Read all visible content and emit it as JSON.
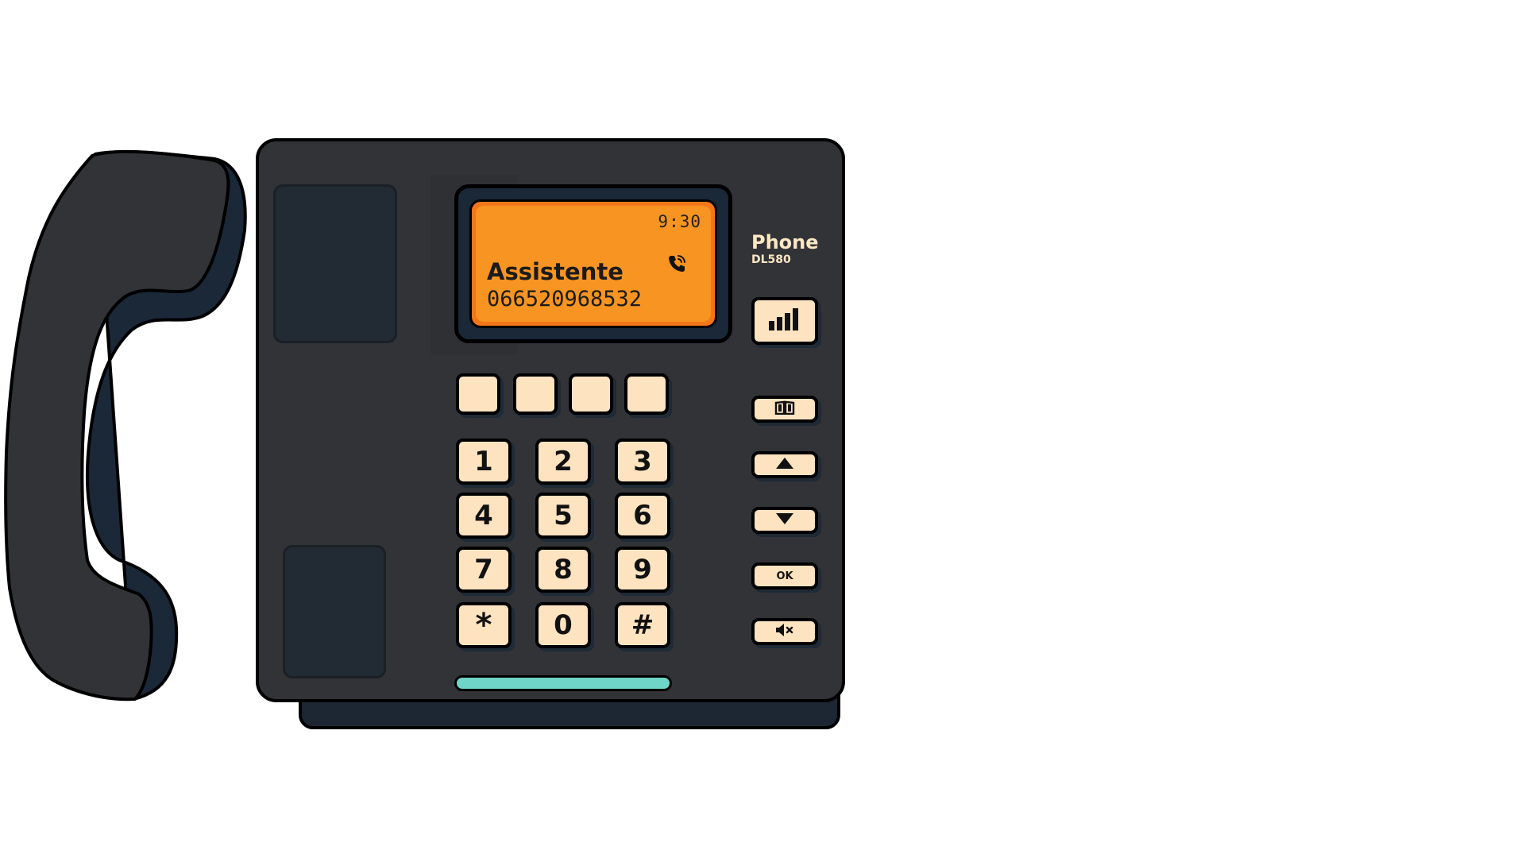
{
  "display": {
    "time": "9:30",
    "caller_name": "Assistente",
    "caller_number": "066520968532",
    "call_icon": "phone-ringing-icon"
  },
  "brand": {
    "name": "Phone",
    "model": "DL580"
  },
  "keypad": {
    "soft_keys": [
      "",
      "",
      "",
      ""
    ],
    "digits": [
      "1",
      "2",
      "3",
      "4",
      "5",
      "6",
      "7",
      "8",
      "9",
      "*",
      "0",
      "#"
    ]
  },
  "side_buttons": {
    "signal_icon": "signal-bars-icon",
    "phonebook_icon": "book-icon",
    "up_icon": "arrow-up-icon",
    "down_icon": "arrow-down-icon",
    "ok_label": "OK",
    "mute_icon": "mute-icon"
  },
  "colors": {
    "body": "#323337",
    "lcd": "#f89421",
    "keys": "#fde3c0",
    "slot": "#6fd5c8",
    "handset_dark": "#1a2838"
  }
}
